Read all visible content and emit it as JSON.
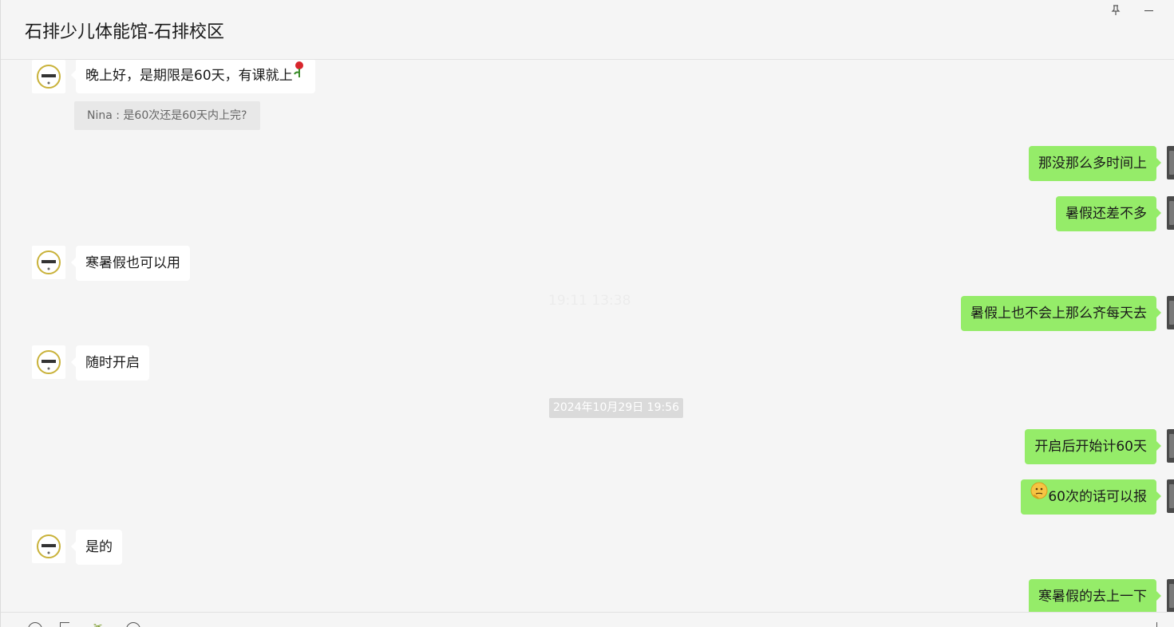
{
  "header": {
    "title": "石排少儿体能馆-石排校区",
    "pin_glyph": "⚲"
  },
  "messages": {
    "m1": "晚上好，是期限是60天，有课就上",
    "m1_quote": "Nina : 是60次还是60天内上完?",
    "m2": "那没那么多时间上",
    "m3": "暑假还差不多",
    "m4": "寒暑假也可以用",
    "m5": "暑假上也不会上那么齐每天去",
    "faded_time": "19:11 13:38",
    "m6": "随时开启",
    "timestamp": "2024年10月29日 19:56",
    "m7": "开启后开始计60天",
    "m8": "60次的话可以报",
    "m9": "是的",
    "m10": "寒暑假的去上一下"
  },
  "colors": {
    "bubble_out": "#95ec69",
    "bubble_in": "#ffffff",
    "background": "#f5f5f5"
  },
  "icons": {
    "rose": "rose-emoji-icon",
    "thinking": "thinking-face-emoji-icon",
    "pin": "pin-icon",
    "minimize": "minimize-icon"
  }
}
